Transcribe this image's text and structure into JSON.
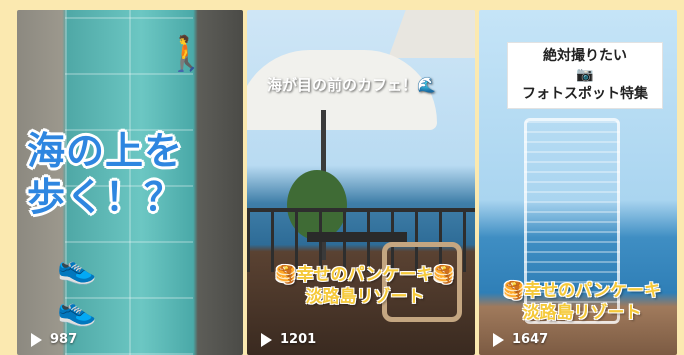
{
  "cards": [
    {
      "caption_line1": "海の上を",
      "caption_line2": "歩く！？",
      "views": "987"
    },
    {
      "top_caption": "海が目の前のカフェ！",
      "caption_line1": "幸せのパンケーキ",
      "caption_line2": "淡路島リゾート",
      "views": "1201"
    },
    {
      "title_line1": "絶対撮りたい",
      "title_line2": "フォトスポット特集",
      "caption_line1": "幸せのパンケーキ",
      "caption_line2": "淡路島リゾート",
      "views": "1647"
    }
  ],
  "icons": [
    "play-icon",
    "walker-emoji",
    "sneaker-emoji",
    "camera-emoji",
    "pancake-emoji",
    "wave-emoji"
  ],
  "colors": {
    "background": "#fbe9b0",
    "caption_blue": "#2e86e0",
    "caption_yellow": "#f5c93a"
  }
}
